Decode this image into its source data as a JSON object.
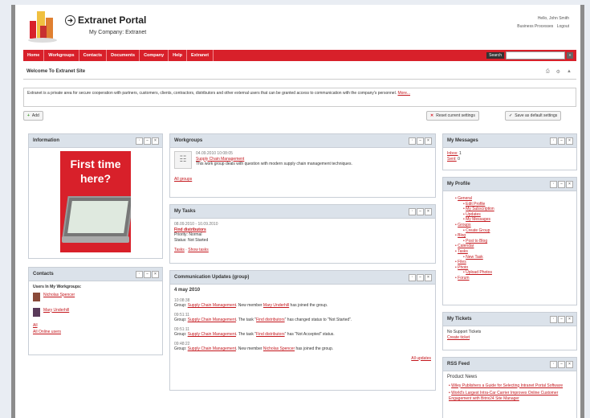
{
  "header": {
    "portal_title": "Extranet Portal",
    "company": "My Company: Extranet",
    "greeting": "Hello, John Smith",
    "links": [
      "Business Processes",
      "Logout"
    ]
  },
  "menu": {
    "items": [
      "Home",
      "Workgroups",
      "Contacts",
      "Documents",
      "Company",
      "Help",
      "Extranet"
    ],
    "search_label": "Search",
    "search_value": "",
    "go_label": "»"
  },
  "page": {
    "title": "Welcome To Extranet Site",
    "description": "Extranet is a private area for secure cooperation with partners, customers, clients, contractors, distributors and other external users that can be granted access to communication with the company's personnel.",
    "more_link": "More...",
    "add_button": "Add",
    "reset_button": "Reset current settings",
    "save_button": "Save as default settings"
  },
  "information": {
    "title": "Information",
    "ad_line1": "First time",
    "ad_line2": "here?"
  },
  "contacts": {
    "title": "Contacts",
    "heading": "Users In My Workgroups:",
    "users": [
      "Nicholas Spencer",
      "Mary Underhill"
    ],
    "all_link": "All",
    "online_link": "All Online users"
  },
  "workgroups": {
    "title": "Workgroups",
    "date": "04.09.2010 10:08:05",
    "group_name": "Supply Chain Management",
    "group_desc": "This work group deals with question with modern supply chain management techniques.",
    "all_link": "All groups"
  },
  "tasks": {
    "title": "My Tasks",
    "date": "08.09.2010 - 10.09.2010",
    "task_name": "Find distributors",
    "priority": "Priority: Normal",
    "status": "Status: Not Started",
    "links": [
      "Tasks",
      "Show tasks"
    ]
  },
  "updates": {
    "title": "Communication Updates (group)",
    "date_heading": "4 may 2010",
    "entries": [
      {
        "time": "10:08:38",
        "group_prefix": "Group: ",
        "group": "Supply Chain Management",
        "pre": ". New member ",
        "link": "Mary Underhill",
        "post": " has joined the group."
      },
      {
        "time": "09:51:11",
        "group_prefix": "Group: ",
        "group": "Supply Chain Management",
        "pre": ". The task \"",
        "link": "Find distributors",
        "post": "\" has changed status to \"Not Started\"."
      },
      {
        "time": "09:51:11",
        "group_prefix": "Group: ",
        "group": "Supply Chain Management",
        "pre": ". The task \"",
        "link": "Find distributors",
        "post": "\" has \"Not Accepted\" status."
      },
      {
        "time": "09:48:22",
        "group_prefix": "Group: ",
        "group": "Supply Chain Management",
        "pre": ". New member ",
        "link": "Nicholas Spencer",
        "post": " has joined the group."
      }
    ],
    "all_link": "All updates"
  },
  "messages": {
    "title": "My Messages",
    "inbox_label": "Inbox:",
    "inbox_count": "1",
    "sent_label": "Sent:",
    "sent_count": "0"
  },
  "profile": {
    "title": "My Profile",
    "general": "General",
    "general_items": [
      "Edit Profile",
      "My Subscription",
      "Updates",
      "My Messages"
    ],
    "groups": "Groups",
    "groups_items": [
      "Create Group"
    ],
    "blog": "Blog",
    "blog_items": [
      "Post to Blog"
    ],
    "calendar": "Calendar",
    "tasks": "Tasks",
    "tasks_items": [
      "New Task"
    ],
    "files": "Files",
    "photo": "Photo",
    "photo_items": [
      "Upload Photos"
    ],
    "forum": "Forum"
  },
  "tickets": {
    "title": "My Tickets",
    "none": "No Support Tickets",
    "create": "Create ticket"
  },
  "rss": {
    "title": "RSS Feed",
    "heading": "Product News",
    "items": [
      "Wiley Publishers a Guide for Selecting Intranet Portal Software",
      "World's Largest Intra-Car Carrier Improves Online Customer Engagement with Bitrix24 Site Manager"
    ]
  },
  "colors": {
    "brand_red": "#d8202a",
    "portlet_header": "#dbe2ea",
    "link": "#c4161c"
  }
}
